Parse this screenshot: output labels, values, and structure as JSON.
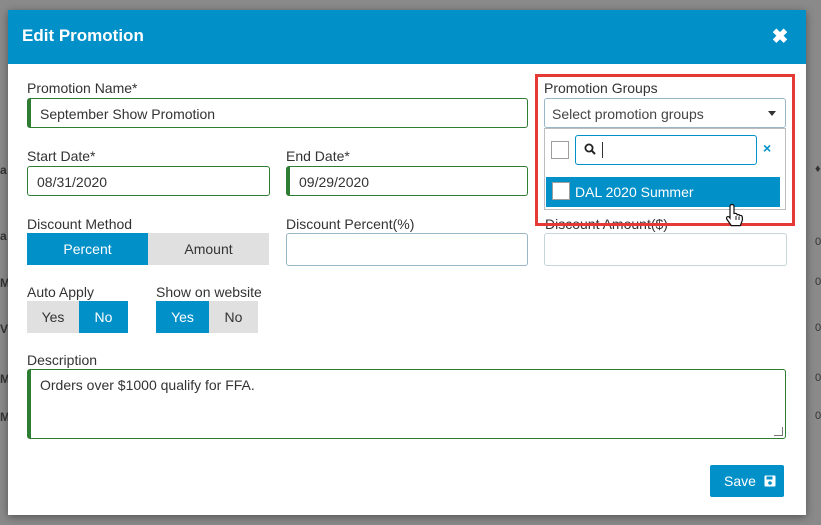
{
  "modal": {
    "title": "Edit Promotion",
    "close_glyph": "✖"
  },
  "form": {
    "promotion_name": {
      "label": "Promotion Name*",
      "value": "September Show Promotion"
    },
    "promotion_groups": {
      "label": "Promotion Groups",
      "placeholder": "Select promotion groups",
      "dropdown": {
        "search_value": "",
        "clear_glyph": "×",
        "options": [
          {
            "label": "DAL 2020 Summer",
            "highlighted": true
          }
        ]
      }
    },
    "start_date": {
      "label": "Start Date*",
      "value": "08/31/2020"
    },
    "end_date": {
      "label": "End Date*",
      "value": "09/29/2020"
    },
    "discount_method": {
      "label": "Discount Method",
      "options": [
        "Percent",
        "Amount"
      ],
      "selected": "Percent"
    },
    "discount_percent": {
      "label": "Discount Percent(%)",
      "value": ""
    },
    "discount_amount": {
      "label": "Discount Amount($)",
      "value": ""
    },
    "auto_apply": {
      "label": "Auto Apply",
      "options": [
        "Yes",
        "No"
      ],
      "selected": "No"
    },
    "show_on_website": {
      "label": "Show on website",
      "options": [
        "Yes",
        "No"
      ],
      "selected": "Yes"
    },
    "description": {
      "label": "Description",
      "value": "Orders over $1000 qualify for FFA."
    }
  },
  "footer": {
    "save_label": "Save",
    "save_icon": "floppy-disk-icon"
  },
  "colors": {
    "primary": "#0290c9",
    "valid_border": "#2e7d32",
    "highlight": "#e53935"
  },
  "background": {
    "left_fragments": [
      "a",
      "a",
      "M",
      "V",
      "M",
      "M"
    ],
    "right_fragments": [
      "♦",
      "0",
      "0",
      "0",
      "0",
      "0"
    ]
  }
}
